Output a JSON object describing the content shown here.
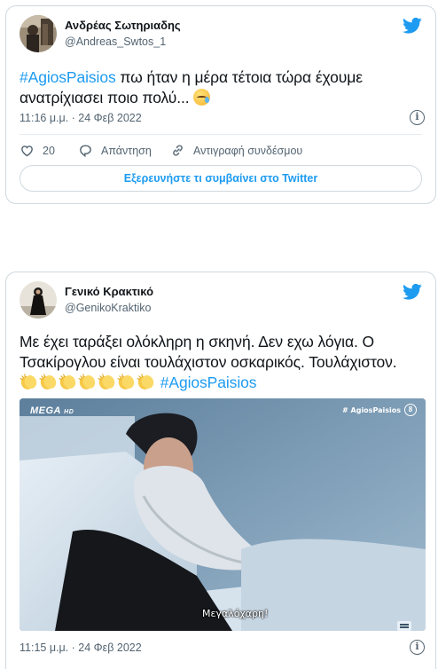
{
  "colors": {
    "accent": "#1d9bf0",
    "text": "#0f1419",
    "muted": "#536471",
    "border": "#cfd9de"
  },
  "tweet1": {
    "author_name": "Ανδρέας Σωτηριαδης",
    "author_handle": "@Andreas_Swtos_1",
    "hashtag": "#AgiosPaisios",
    "text_line1": " πω ήταν η μέρα τέτοια τώρα έχουμε",
    "text_line2": "ανατρίχιασει ποιο πολύ... ",
    "emoji": "sad-but-relieved-face",
    "timestamp": "11:16 μ.μ. · 24 Φεβ 2022",
    "like_count": "20",
    "reply_label": "Απάντηση",
    "copy_link_label": "Αντιγραφή συνδέσμου",
    "explore_label": "Εξερευνήστε τι συμβαίνει στο Twitter"
  },
  "tweet2": {
    "author_name": "Γενικό Κρακτικό",
    "author_handle": "@GenikoKraktiko",
    "text_line1": "Με έχει ταράξει ολόκληρη η σκηνή. Δεν εχω λόγια. Ο",
    "text_line2": "Τσακίρογλου είναι τουλάχιστον οσκαρικός. Τουλάχιστον.",
    "clap_count": 7,
    "hashtag": "#AgiosPaisios",
    "media": {
      "channel_logo": "MEGA",
      "channel_logo_suffix": "HD",
      "tag": "# AgiosPaisios",
      "rating": "8",
      "subtitle": "Μεγαλόχαρη!"
    },
    "timestamp": "11:15 μ.μ. · 24 Φεβ 2022"
  },
  "icons": {
    "brand": "twitter-bird-icon",
    "like": "heart-icon",
    "reply": "speech-bubble-icon",
    "copy_link": "link-icon",
    "info": "info-icon",
    "captions": "captions-icon"
  }
}
